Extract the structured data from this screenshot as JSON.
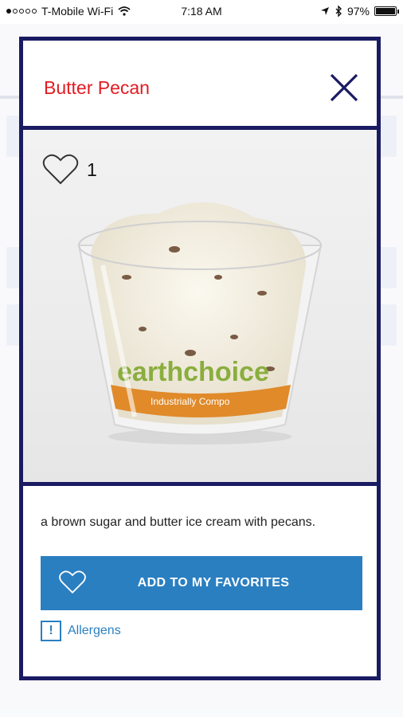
{
  "status_bar": {
    "carrier": "T-Mobile Wi-Fi",
    "time": "7:18 AM",
    "battery": "97%",
    "battery_level": 0.97,
    "signal_bars": 1,
    "icons": [
      "signal-dots-icon",
      "wifi-icon",
      "location-arrow-icon",
      "bluetooth-icon",
      "battery-icon"
    ]
  },
  "modal": {
    "title": "Butter Pecan",
    "close_icon": "close-x-icon",
    "favorites_count": "1",
    "photo_label": "earthchoice",
    "photo_band_text": "Industrially Compo",
    "description": "a brown sugar and butter ice cream with pecans.",
    "add_favorites_label": "ADD TO MY FAVORITES",
    "allergens_label": "Allergens"
  },
  "colors": {
    "frame": "#1a1b62",
    "title": "#e31b23",
    "button": "#2a7fc1",
    "link": "#2a7fc1"
  }
}
